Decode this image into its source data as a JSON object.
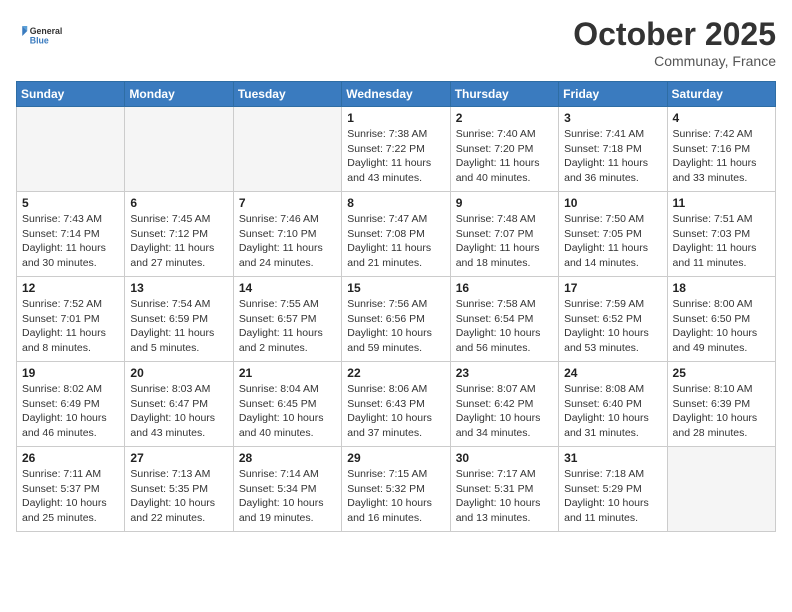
{
  "header": {
    "logo_line1": "General",
    "logo_line2": "Blue",
    "month": "October 2025",
    "location": "Communay, France"
  },
  "days_of_week": [
    "Sunday",
    "Monday",
    "Tuesday",
    "Wednesday",
    "Thursday",
    "Friday",
    "Saturday"
  ],
  "weeks": [
    [
      {
        "num": "",
        "empty": true
      },
      {
        "num": "",
        "empty": true
      },
      {
        "num": "",
        "empty": true
      },
      {
        "num": "1",
        "sunrise": "7:38 AM",
        "sunset": "7:22 PM",
        "daylight": "11 hours and 43 minutes."
      },
      {
        "num": "2",
        "sunrise": "7:40 AM",
        "sunset": "7:20 PM",
        "daylight": "11 hours and 40 minutes."
      },
      {
        "num": "3",
        "sunrise": "7:41 AM",
        "sunset": "7:18 PM",
        "daylight": "11 hours and 36 minutes."
      },
      {
        "num": "4",
        "sunrise": "7:42 AM",
        "sunset": "7:16 PM",
        "daylight": "11 hours and 33 minutes."
      }
    ],
    [
      {
        "num": "5",
        "sunrise": "7:43 AM",
        "sunset": "7:14 PM",
        "daylight": "11 hours and 30 minutes."
      },
      {
        "num": "6",
        "sunrise": "7:45 AM",
        "sunset": "7:12 PM",
        "daylight": "11 hours and 27 minutes."
      },
      {
        "num": "7",
        "sunrise": "7:46 AM",
        "sunset": "7:10 PM",
        "daylight": "11 hours and 24 minutes."
      },
      {
        "num": "8",
        "sunrise": "7:47 AM",
        "sunset": "7:08 PM",
        "daylight": "11 hours and 21 minutes."
      },
      {
        "num": "9",
        "sunrise": "7:48 AM",
        "sunset": "7:07 PM",
        "daylight": "11 hours and 18 minutes."
      },
      {
        "num": "10",
        "sunrise": "7:50 AM",
        "sunset": "7:05 PM",
        "daylight": "11 hours and 14 minutes."
      },
      {
        "num": "11",
        "sunrise": "7:51 AM",
        "sunset": "7:03 PM",
        "daylight": "11 hours and 11 minutes."
      }
    ],
    [
      {
        "num": "12",
        "sunrise": "7:52 AM",
        "sunset": "7:01 PM",
        "daylight": "11 hours and 8 minutes."
      },
      {
        "num": "13",
        "sunrise": "7:54 AM",
        "sunset": "6:59 PM",
        "daylight": "11 hours and 5 minutes."
      },
      {
        "num": "14",
        "sunrise": "7:55 AM",
        "sunset": "6:57 PM",
        "daylight": "11 hours and 2 minutes."
      },
      {
        "num": "15",
        "sunrise": "7:56 AM",
        "sunset": "6:56 PM",
        "daylight": "10 hours and 59 minutes."
      },
      {
        "num": "16",
        "sunrise": "7:58 AM",
        "sunset": "6:54 PM",
        "daylight": "10 hours and 56 minutes."
      },
      {
        "num": "17",
        "sunrise": "7:59 AM",
        "sunset": "6:52 PM",
        "daylight": "10 hours and 53 minutes."
      },
      {
        "num": "18",
        "sunrise": "8:00 AM",
        "sunset": "6:50 PM",
        "daylight": "10 hours and 49 minutes."
      }
    ],
    [
      {
        "num": "19",
        "sunrise": "8:02 AM",
        "sunset": "6:49 PM",
        "daylight": "10 hours and 46 minutes."
      },
      {
        "num": "20",
        "sunrise": "8:03 AM",
        "sunset": "6:47 PM",
        "daylight": "10 hours and 43 minutes."
      },
      {
        "num": "21",
        "sunrise": "8:04 AM",
        "sunset": "6:45 PM",
        "daylight": "10 hours and 40 minutes."
      },
      {
        "num": "22",
        "sunrise": "8:06 AM",
        "sunset": "6:43 PM",
        "daylight": "10 hours and 37 minutes."
      },
      {
        "num": "23",
        "sunrise": "8:07 AM",
        "sunset": "6:42 PM",
        "daylight": "10 hours and 34 minutes."
      },
      {
        "num": "24",
        "sunrise": "8:08 AM",
        "sunset": "6:40 PM",
        "daylight": "10 hours and 31 minutes."
      },
      {
        "num": "25",
        "sunrise": "8:10 AM",
        "sunset": "6:39 PM",
        "daylight": "10 hours and 28 minutes."
      }
    ],
    [
      {
        "num": "26",
        "sunrise": "7:11 AM",
        "sunset": "5:37 PM",
        "daylight": "10 hours and 25 minutes."
      },
      {
        "num": "27",
        "sunrise": "7:13 AM",
        "sunset": "5:35 PM",
        "daylight": "10 hours and 22 minutes."
      },
      {
        "num": "28",
        "sunrise": "7:14 AM",
        "sunset": "5:34 PM",
        "daylight": "10 hours and 19 minutes."
      },
      {
        "num": "29",
        "sunrise": "7:15 AM",
        "sunset": "5:32 PM",
        "daylight": "10 hours and 16 minutes."
      },
      {
        "num": "30",
        "sunrise": "7:17 AM",
        "sunset": "5:31 PM",
        "daylight": "10 hours and 13 minutes."
      },
      {
        "num": "31",
        "sunrise": "7:18 AM",
        "sunset": "5:29 PM",
        "daylight": "10 hours and 11 minutes."
      },
      {
        "num": "",
        "empty": true
      }
    ]
  ]
}
